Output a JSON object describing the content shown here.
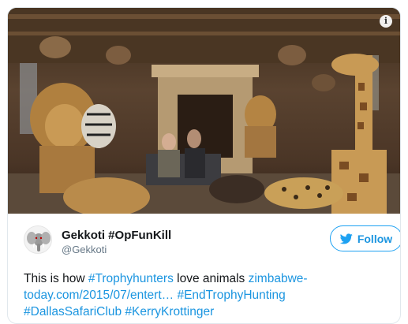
{
  "media": {
    "info_icon": "info-icon",
    "info_glyph": "i"
  },
  "author": {
    "display_name": "Gekkoti #OpFunKill",
    "handle": "@Gekkoti",
    "avatar_icon": "elephant-avatar"
  },
  "follow": {
    "label": "Follow",
    "icon": "twitter-bird-icon"
  },
  "tweet": {
    "t1": "This is how ",
    "link1": "#Trophyhunters",
    "t2": " love animals ",
    "link2": "zimbabwe-today.com/2015/07/entert…",
    "t3": " ",
    "link3": "#EndTrophyHunting",
    "t4": " ",
    "link4": "#DallasSafariClub",
    "t5": " ",
    "link5": "#KerryKrottinger"
  },
  "colors": {
    "link": "#1b95e0",
    "border": "#e1e8ed",
    "muted": "#657786"
  }
}
